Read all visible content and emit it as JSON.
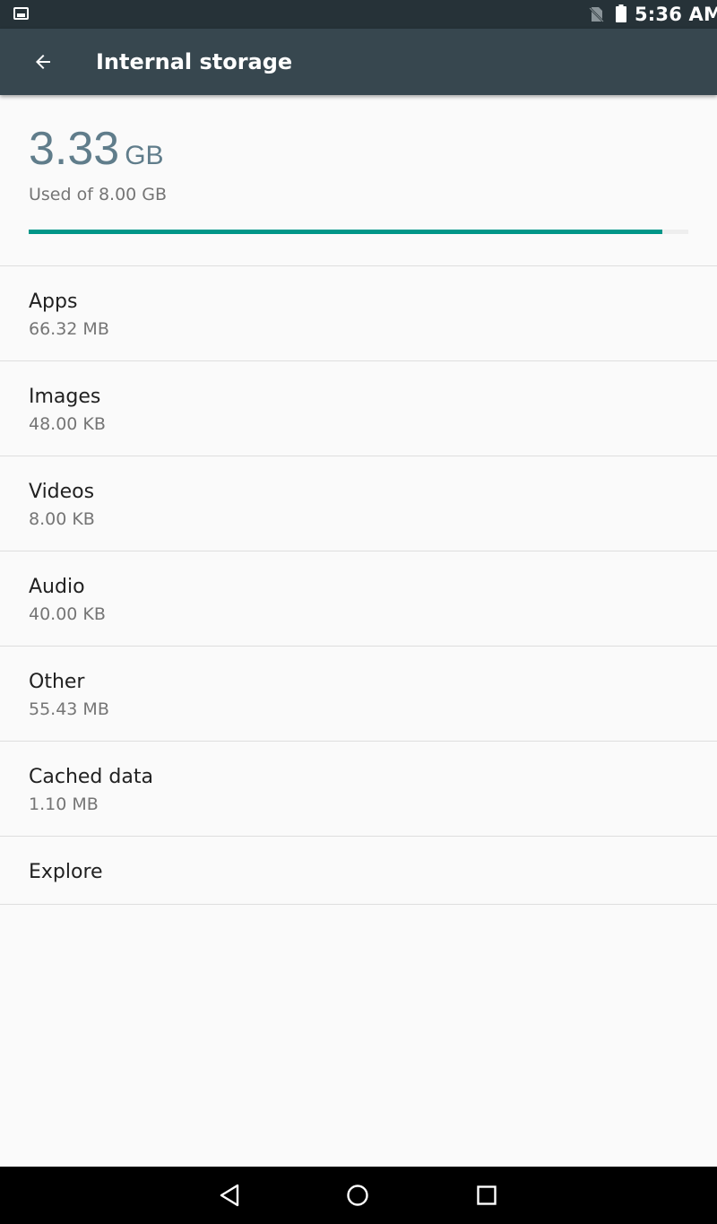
{
  "status_bar": {
    "time": "5:36 AM",
    "icons": [
      "gallery-notification-icon",
      "no-sim-icon",
      "battery-icon"
    ]
  },
  "app_bar": {
    "back_icon": "arrow-back-icon",
    "title": "Internal storage"
  },
  "summary": {
    "used_value": "3.33",
    "used_unit": "GB",
    "used_label": "Used of 8.00 GB",
    "progress_fraction": 0.96,
    "progress_color": "#009688"
  },
  "categories": [
    {
      "label": "Apps",
      "size": "66.32 MB"
    },
    {
      "label": "Images",
      "size": "48.00 KB"
    },
    {
      "label": "Videos",
      "size": "8.00 KB"
    },
    {
      "label": "Audio",
      "size": "40.00 KB"
    },
    {
      "label": "Other",
      "size": "55.43 MB"
    },
    {
      "label": "Cached data",
      "size": "1.10 MB"
    }
  ],
  "explore": {
    "label": "Explore"
  },
  "nav_bar": {
    "icons": [
      "nav-back-icon",
      "nav-home-icon",
      "nav-recents-icon"
    ]
  },
  "colors": {
    "status_bar": "#263238",
    "app_bar": "#37474f",
    "accent": "#009688",
    "used_value": "#607d8b"
  }
}
